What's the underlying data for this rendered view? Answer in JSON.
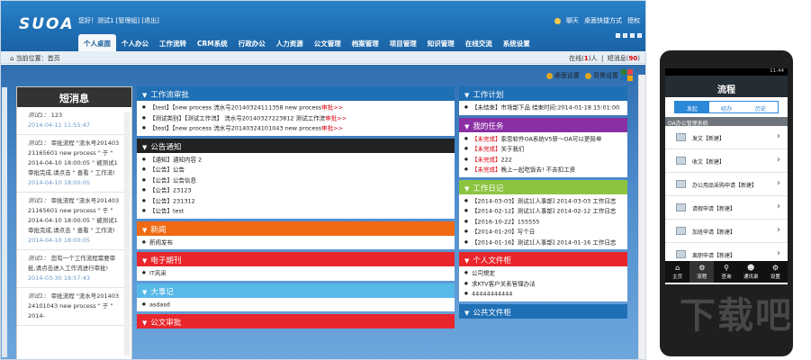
{
  "app": {
    "logo": "SUOA",
    "greeting": "您好！测试1 [管理组]",
    "logout": "[退出]",
    "top_links": [
      "聊天",
      "桌面快捷方式",
      "授权"
    ]
  },
  "nav": [
    "个人桌面",
    "个人办公",
    "工作流转",
    "CRM系统",
    "行政办公",
    "人力资源",
    "公文管理",
    "档案管理",
    "项目管理",
    "知识管理",
    "在线交流",
    "系统设置"
  ],
  "breadcrumb": {
    "prefix": "当前位置：",
    "current": "首页"
  },
  "online": {
    "label": "在线",
    "count": "1",
    "unit": "人",
    "short_msg": "短消息",
    "short_count": "90"
  },
  "tools": {
    "desktop_settings": "桌面设置",
    "background_settings": "背景设置"
  },
  "messages": {
    "title": "短消息",
    "items": [
      {
        "from": "测试1：",
        "text": "123",
        "date": "2014-04-11 11:55:47"
      },
      {
        "from": "测试1：",
        "text": "审批流程 \"流水号201403 21165601 new process \" 于 \" 2014-04-10 18:00:05 \" 被测试1审批完成,请点击 \" 查看 \" 工作流!",
        "date": "2014-04-10 18:00:05"
      },
      {
        "from": "测试1：",
        "text": "审批流程 \"流水号201403 21165601 new process \" 于 \" 2014-04-10 18:00:05 \" 被测试1审批完成,请点击 \" 查看 \" 工作流!",
        "date": "2014-04-10 18:00:05"
      },
      {
        "from": "测试1：",
        "text": "您有一个工作流程需要审批,请点击进入工作流进行审批!",
        "date": "2014-03-30 18:57:43"
      },
      {
        "from": "测试1：",
        "text": "审批流程 \"流水号201403 24101043 new process \" 于 \" 2014-",
        "date": ""
      }
    ]
  },
  "panels_mid": [
    {
      "title": "工作流审批",
      "color": "#1f6fb5",
      "rows": [
        {
          "text": "【test】【new process 流水号20140324111358 new process",
          "tag": "审批>>"
        },
        {
          "text": "【测试类别】【测试工作流】 流水号20140327223812 测试工作流",
          "tag": "审批>>"
        },
        {
          "text": "【test】【new process 流水号20140324101043 new process",
          "tag": "审批>>"
        }
      ]
    },
    {
      "title": "公告通知",
      "color": "#222",
      "rows": [
        {
          "text": "【通知】通知内容 2",
          "tag": ""
        },
        {
          "text": "【公告】公告",
          "tag": ""
        },
        {
          "text": "【公告】公告信息",
          "tag": ""
        },
        {
          "text": "【公告】23123",
          "tag": ""
        },
        {
          "text": "【公告】231312",
          "tag": ""
        },
        {
          "text": "【公告】test",
          "tag": ""
        }
      ]
    },
    {
      "title": "新闻",
      "color": "#ef6a12",
      "rows": [
        {
          "text": "新闻发布",
          "tag": ""
        }
      ]
    },
    {
      "title": "电子期刊",
      "color": "#e8262b",
      "rows": [
        {
          "text": "IT风采",
          "tag": ""
        }
      ]
    },
    {
      "title": "大事记",
      "color": "#57b9e8",
      "rows": [
        {
          "text": "asdasd",
          "tag": ""
        }
      ]
    },
    {
      "title": "公文审批",
      "color": "#e8262b",
      "rows": []
    }
  ],
  "panels_right": [
    {
      "title": "工作计划",
      "color": "#1f6fb5",
      "rows": [
        {
          "text": "【未结束】市场部下品 结束时间:2014-01-18 15:01:00",
          "tag": ""
        }
      ]
    },
    {
      "title": "我的任务",
      "color": "#8b2fa4",
      "rows": [
        {
          "text": "",
          "tag": "【未完成】",
          "after": "索思软件OA系统V5新～OA可以更简单"
        },
        {
          "text": "",
          "tag": "【未完成】",
          "after": "关于我们"
        },
        {
          "text": "",
          "tag": "【未完成】",
          "after": "222"
        },
        {
          "text": "",
          "tag": "【未完成】",
          "after": "晚上一起吃饭去! 不去扣工资"
        }
      ]
    },
    {
      "title": "工作日记",
      "color": "#8cc43f",
      "rows": [
        {
          "text": "【2014-03-03】测试1[人事部] 2014-03-03 工作日志",
          "tag": ""
        },
        {
          "text": "【2014-02-12】测试1[人事部] 2014-02-12 工作日志",
          "tag": ""
        },
        {
          "text": "【2016-10-22】155555",
          "tag": ""
        },
        {
          "text": "【2014-01-20】写个日",
          "tag": ""
        },
        {
          "text": "【2014-01-16】测试1[人事部] 2014-01-16 工作日志",
          "tag": ""
        }
      ]
    },
    {
      "title": "个人文件柜",
      "color": "#e8262b",
      "rows": [
        {
          "text": "公司規定",
          "tag": ""
        },
        {
          "text": "求KTV客户关系管理办法",
          "tag": ""
        },
        {
          "text": "44444444444",
          "tag": ""
        }
      ]
    },
    {
      "title": "公共文件柜",
      "color": "#1f6fb5",
      "rows": []
    }
  ],
  "phone": {
    "time": "11:44",
    "title": "流程",
    "tabs": [
      "发起",
      "经办",
      "历史"
    ],
    "section": "OA办公管理系统",
    "rows": [
      "发文【新建】",
      "收文【新建】",
      "办公用品采购申请【新建】",
      "请假申请【新建】",
      "加班申请【新建】",
      "离职申请【新建】"
    ],
    "bottom": [
      "主页",
      "流程",
      "查询",
      "通讯录",
      "设置"
    ]
  },
  "watermark": "下载吧"
}
